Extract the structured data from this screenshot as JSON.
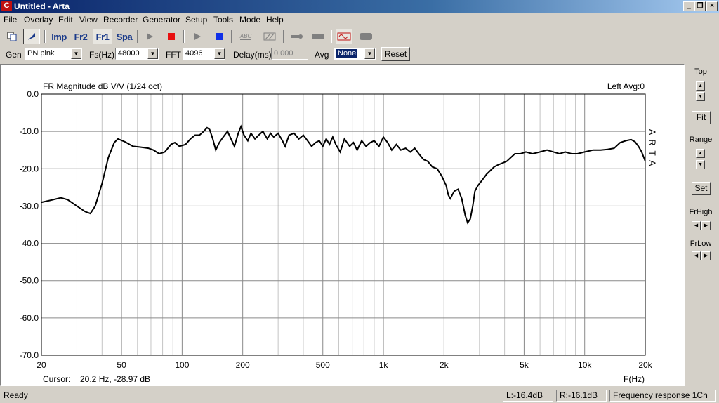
{
  "window": {
    "title": "Untitled - Arta",
    "app_icon": "arta-app-icon"
  },
  "menu": [
    "File",
    "Overlay",
    "Edit",
    "View",
    "Recorder",
    "Generator",
    "Setup",
    "Tools",
    "Mode",
    "Help"
  ],
  "toolbar": {
    "imp_label": "Imp",
    "fr2_label": "Fr2",
    "fr1_label": "Fr1",
    "spa_label": "Spa",
    "abc_label": "ABC"
  },
  "controls": {
    "gen_label": "Gen",
    "gen_value": "PN pink",
    "fs_label": "Fs(Hz)",
    "fs_value": "48000",
    "fft_label": "FFT",
    "fft_value": "4096",
    "delay_label": "Delay(ms)",
    "delay_value": "0.000",
    "avg_label": "Avg",
    "avg_value": "None",
    "reset_label": "Reset"
  },
  "plot": {
    "title": "FR Magnitude dB V/V (1/24 oct)",
    "channel_info": "Left Avg:0",
    "watermark": "A R T A",
    "cursor_label": "Cursor:",
    "cursor_value": "20.2 Hz, -28.97 dB",
    "x_axis_label": "F(Hz)"
  },
  "chart_data": {
    "type": "line",
    "title": "FR Magnitude dB V/V (1/24 oct)",
    "xlabel": "F(Hz)",
    "ylabel": "",
    "x_scale": "log",
    "xlim": [
      20,
      20000
    ],
    "ylim": [
      -70,
      0
    ],
    "grid": true,
    "x_ticks": [
      "20",
      "50",
      "100",
      "200",
      "500",
      "1k",
      "2k",
      "5k",
      "10k",
      "20k"
    ],
    "y_ticks": [
      "0.0",
      "-10.0",
      "-20.0",
      "-30.0",
      "-40.0",
      "-50.0",
      "-60.0",
      "-70.0"
    ],
    "series": [
      {
        "name": "",
        "color": "#000000",
        "points": [
          [
            20,
            -29
          ],
          [
            22,
            -28.5
          ],
          [
            25,
            -27.8
          ],
          [
            27,
            -28.3
          ],
          [
            30,
            -30
          ],
          [
            33,
            -31.5
          ],
          [
            35,
            -32
          ],
          [
            37,
            -30
          ],
          [
            40,
            -24
          ],
          [
            43,
            -17
          ],
          [
            46,
            -13
          ],
          [
            48,
            -12
          ],
          [
            52,
            -12.8
          ],
          [
            57,
            -14
          ],
          [
            62,
            -14.2
          ],
          [
            68,
            -14.5
          ],
          [
            72,
            -15
          ],
          [
            77,
            -16
          ],
          [
            82,
            -15.5
          ],
          [
            88,
            -13.5
          ],
          [
            92,
            -13
          ],
          [
            97,
            -14
          ],
          [
            104,
            -13.5
          ],
          [
            110,
            -12
          ],
          [
            116,
            -11
          ],
          [
            122,
            -11
          ],
          [
            128,
            -10
          ],
          [
            133,
            -9
          ],
          [
            137,
            -9.5
          ],
          [
            142,
            -12
          ],
          [
            147,
            -15
          ],
          [
            153,
            -13
          ],
          [
            160,
            -11.5
          ],
          [
            168,
            -10
          ],
          [
            175,
            -12
          ],
          [
            182,
            -14
          ],
          [
            190,
            -10.5
          ],
          [
            196,
            -8.7
          ],
          [
            203,
            -11
          ],
          [
            212,
            -12.5
          ],
          [
            220,
            -10.5
          ],
          [
            230,
            -12
          ],
          [
            240,
            -11
          ],
          [
            252,
            -10
          ],
          [
            265,
            -12
          ],
          [
            275,
            -10.5
          ],
          [
            285,
            -11.5
          ],
          [
            300,
            -10.5
          ],
          [
            315,
            -12.5
          ],
          [
            325,
            -14
          ],
          [
            340,
            -11
          ],
          [
            360,
            -10.5
          ],
          [
            380,
            -12
          ],
          [
            400,
            -11
          ],
          [
            420,
            -12.5
          ],
          [
            440,
            -14
          ],
          [
            460,
            -13
          ],
          [
            480,
            -12.5
          ],
          [
            500,
            -14
          ],
          [
            520,
            -12
          ],
          [
            540,
            -13.5
          ],
          [
            560,
            -11.5
          ],
          [
            580,
            -13.5
          ],
          [
            610,
            -15.5
          ],
          [
            640,
            -12
          ],
          [
            680,
            -14
          ],
          [
            710,
            -13
          ],
          [
            740,
            -15
          ],
          [
            780,
            -12.5
          ],
          [
            820,
            -14
          ],
          [
            860,
            -13
          ],
          [
            900,
            -12.5
          ],
          [
            950,
            -14
          ],
          [
            1000,
            -11.5
          ],
          [
            1050,
            -13
          ],
          [
            1100,
            -15
          ],
          [
            1160,
            -13.5
          ],
          [
            1220,
            -15
          ],
          [
            1290,
            -14.5
          ],
          [
            1360,
            -15.5
          ],
          [
            1430,
            -14.5
          ],
          [
            1500,
            -16
          ],
          [
            1580,
            -17.5
          ],
          [
            1660,
            -18
          ],
          [
            1750,
            -19.5
          ],
          [
            1850,
            -20
          ],
          [
            1950,
            -22
          ],
          [
            2050,
            -24.5
          ],
          [
            2100,
            -27
          ],
          [
            2150,
            -28
          ],
          [
            2250,
            -26
          ],
          [
            2350,
            -25.5
          ],
          [
            2450,
            -28
          ],
          [
            2550,
            -32.5
          ],
          [
            2620,
            -34.5
          ],
          [
            2700,
            -33.5
          ],
          [
            2780,
            -30
          ],
          [
            2850,
            -26
          ],
          [
            2950,
            -24.5
          ],
          [
            3050,
            -23.5
          ],
          [
            3150,
            -22.5
          ],
          [
            3250,
            -21.5
          ],
          [
            3400,
            -20.5
          ],
          [
            3550,
            -19.5
          ],
          [
            3700,
            -19
          ],
          [
            3900,
            -18.5
          ],
          [
            4100,
            -18
          ],
          [
            4300,
            -17
          ],
          [
            4500,
            -16
          ],
          [
            4800,
            -16
          ],
          [
            5100,
            -15.5
          ],
          [
            5500,
            -16
          ],
          [
            6000,
            -15.5
          ],
          [
            6500,
            -15
          ],
          [
            7000,
            -15.5
          ],
          [
            7500,
            -16
          ],
          [
            8000,
            -15.5
          ],
          [
            8600,
            -16
          ],
          [
            9200,
            -16
          ],
          [
            10000,
            -15.5
          ],
          [
            11000,
            -15
          ],
          [
            12000,
            -15
          ],
          [
            13000,
            -14.8
          ],
          [
            14000,
            -14.5
          ],
          [
            15000,
            -13
          ],
          [
            16000,
            -12.5
          ],
          [
            17000,
            -12.2
          ],
          [
            17800,
            -12.8
          ],
          [
            18500,
            -14
          ],
          [
            19200,
            -15.5
          ],
          [
            20000,
            -18
          ]
        ]
      }
    ]
  },
  "right_panel": {
    "top_label": "Top",
    "fit_label": "Fit",
    "range_label": "Range",
    "set_label": "Set",
    "frhigh_label": "FrHigh",
    "frlow_label": "FrLow"
  },
  "status": {
    "ready": "Ready",
    "left_level": "L:-16.4dB",
    "right_level": "R:-16.1dB",
    "mode": "Frequency response 1Ch"
  }
}
